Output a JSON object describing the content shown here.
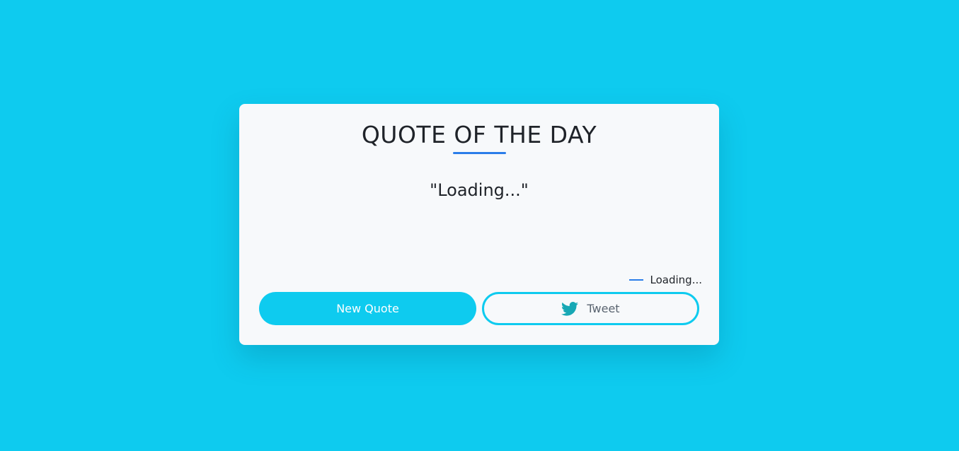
{
  "colors": {
    "background": "#0ecbef",
    "card": "#f7f9fb",
    "accent": "#2b7de9",
    "twitter_icon": "#17a8b5"
  },
  "card": {
    "title": "QUOTE OF THE DAY",
    "quote": "\"Loading...\"",
    "author": "Loading..."
  },
  "actions": {
    "new_quote_label": "New Quote",
    "tweet_label": "Tweet",
    "tweet_icon": "twitter-bird-icon"
  }
}
